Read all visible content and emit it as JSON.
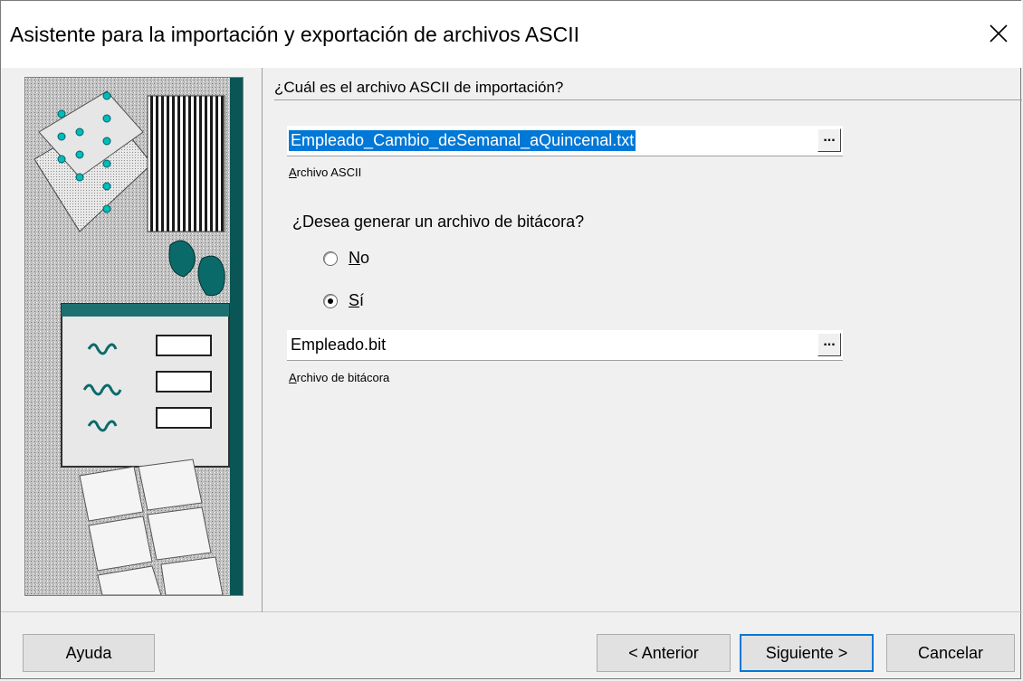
{
  "window": {
    "title": "Asistente para la importación y exportación de archivos ASCII"
  },
  "import_section": {
    "question": "¿Cuál es el archivo ASCII de importación?",
    "file_value": "Empleado_Cambio_deSemanal_aQuincenal.txt",
    "browse_label": "...",
    "caption_first": "A",
    "caption_rest": "rchivo ASCII"
  },
  "log_section": {
    "question": "¿Desea generar un archivo de bitácora?",
    "options": [
      {
        "first": "N",
        "rest": "o",
        "selected": false
      },
      {
        "first": "S",
        "rest": "í",
        "selected": true
      }
    ],
    "file_value": "Empleado.bit",
    "browse_label": "...",
    "caption_first": "A",
    "caption_rest": "rchivo de bitácora"
  },
  "footer": {
    "help": "Ayuda",
    "back": "< Anterior",
    "next": "Siguiente >",
    "cancel": "Cancelar"
  },
  "colors": {
    "selection": "#0078d7",
    "teal_accent": "#00c8c8"
  },
  "icons": [
    "close-icon",
    "wizard-illustration"
  ]
}
